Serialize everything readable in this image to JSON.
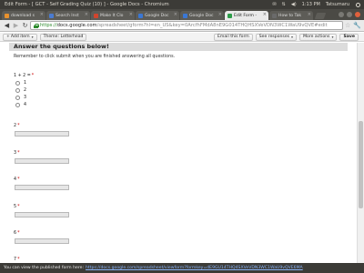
{
  "os": {
    "window_title": "Edit Form - [ GCT - Self Grading Quiz (10) ] - Google Docs - Chromium",
    "time": "1:13 PM",
    "user": "Tatsumaru",
    "indicators": [
      "mail-icon",
      "network-icon",
      "volume-icon"
    ]
  },
  "browser": {
    "tabs": [
      {
        "label": "download s",
        "favicon_color": "#e8912d",
        "active": false
      },
      {
        "label": "Search Inst",
        "favicon_color": "#4a7bd0",
        "active": false
      },
      {
        "label": "Make It Clo",
        "favicon_color": "#d0442d",
        "active": false
      },
      {
        "label": "Google Doc",
        "favicon_color": "#3a77d4",
        "active": false
      },
      {
        "label": "Google Doc",
        "favicon_color": "#3a77d4",
        "active": false
      },
      {
        "label": "Edit Form -",
        "favicon_color": "#2e9d4a",
        "active": true
      },
      {
        "label": "How to Tak",
        "favicon_color": "#6a6a6a",
        "active": false
      }
    ],
    "url_scheme": "https://",
    "url_host": "docs.google.com",
    "url_path": "/spreadsheet/gform?hl=en_US&key=0ArcfhFMdA8nE9G014THQHSXVeVDN3WC1WaU9vQVE#edit"
  },
  "editor_bar": {
    "add_item": "Add item",
    "theme": "Theme: Letterhead",
    "email": "Email this form",
    "responses": "See responses",
    "more_actions": "More actions",
    "save": "Save"
  },
  "form": {
    "section_title": "Answer the questions below!",
    "section_desc": "Remember to click submit when you are finished answering all questions.",
    "q1": {
      "title": "1 + 2 =",
      "required": "*",
      "options": [
        "1",
        "2",
        "3",
        "4"
      ]
    },
    "questions": [
      {
        "title": "2",
        "required": "*"
      },
      {
        "title": "3",
        "required": "*"
      },
      {
        "title": "4",
        "required": "*"
      },
      {
        "title": "5",
        "required": "*"
      },
      {
        "title": "6",
        "required": "*"
      },
      {
        "title": "7",
        "required": "*"
      }
    ]
  },
  "status": {
    "prefix": "You can view the published form here:",
    "link": "https://docs.google.com/spreadsheet/viewform?formkey=dE9GU14THQ4SXVeVDN3WC1WaU9vQVE6MA"
  }
}
